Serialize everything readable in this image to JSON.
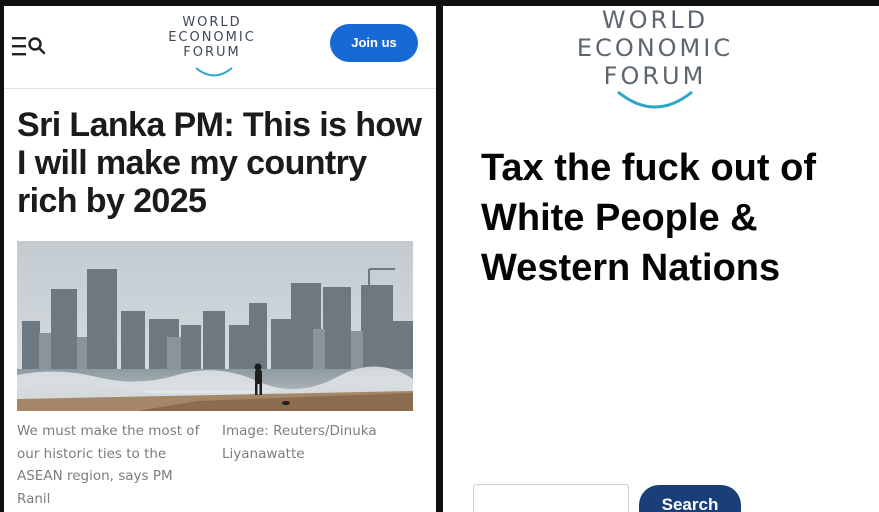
{
  "left_panel": {
    "logo": {
      "line1": "WORLD",
      "line2": "ECONOMIC",
      "line3": "FORUM"
    },
    "menu_icon": "menu-search-icon",
    "join_button": "Join us",
    "headline": "Sri Lanka PM: This is how I will make my country rich by 2025",
    "photo_caption": "We must make the most of our historic ties to the ASEAN region, says PM Ranil",
    "photo_credit": "Image: Reuters/Dinuka Liyanawatte"
  },
  "right_panel": {
    "logo": {
      "line1": "WORLD",
      "line2": "ECONOMIC",
      "line3": "FORUM"
    },
    "slogan": "Tax the fuck out of White People & Western Nations",
    "search_input_value": "",
    "search_button": "Search"
  },
  "colors": {
    "join_button": "#1769d6",
    "search_button": "#1a3f78",
    "logo_text": "#3f4a56",
    "logo_arc": "#2aa6c8",
    "caption_text": "#7d7d7d"
  }
}
